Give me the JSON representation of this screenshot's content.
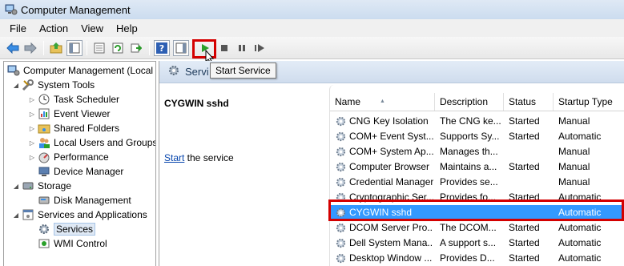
{
  "window": {
    "title": "Computer Management"
  },
  "menu": {
    "items": [
      "File",
      "Action",
      "View",
      "Help"
    ]
  },
  "toolbar": {
    "buttons": [
      "back-icon",
      "forward-icon",
      "up-folder-icon",
      "show-hide-tree-icon",
      "properties-icon",
      "refresh-icon",
      "export-icon",
      "help-icon",
      "show-action-pane-icon",
      "start-service-icon",
      "stop-service-icon",
      "pause-service-icon",
      "restart-service-icon"
    ],
    "tooltip": "Start Service",
    "highlight_color": "#d40000"
  },
  "tree": {
    "root": "Computer Management (Local",
    "system_tools": "System Tools",
    "task_scheduler": "Task Scheduler",
    "event_viewer": "Event Viewer",
    "shared_folders": "Shared Folders",
    "local_users": "Local Users and Groups",
    "performance": "Performance",
    "device_manager": "Device Manager",
    "storage": "Storage",
    "disk_management": "Disk Management",
    "services_apps": "Services and Applications",
    "services": "Services",
    "wmi_control": "WMI Control"
  },
  "right": {
    "header_title": "Servi",
    "selected_service": "CYGWIN sshd",
    "action_link": "Start",
    "action_rest": " the service"
  },
  "columns": {
    "name": "Name",
    "description": "Description",
    "status": "Status",
    "startup": "Startup Type"
  },
  "services": [
    {
      "name": "CNG Key Isolation",
      "description": "The CNG ke...",
      "status": "Started",
      "startup": "Manual"
    },
    {
      "name": "COM+ Event Syst...",
      "description": "Supports Sy...",
      "status": "Started",
      "startup": "Automatic"
    },
    {
      "name": "COM+ System Ap...",
      "description": "Manages th...",
      "status": "",
      "startup": "Manual"
    },
    {
      "name": "Computer Browser",
      "description": "Maintains a...",
      "status": "Started",
      "startup": "Manual"
    },
    {
      "name": "Credential Manager",
      "description": "Provides se...",
      "status": "",
      "startup": "Manual"
    },
    {
      "name": "Cryptographic Ser...",
      "description": "Provides fo...",
      "status": "Started",
      "startup": "Automatic"
    },
    {
      "name": "CYGWIN sshd",
      "description": "",
      "status": "",
      "startup": "Automatic"
    },
    {
      "name": "DCOM Server Pro...",
      "description": "The DCOM...",
      "status": "Started",
      "startup": "Automatic"
    },
    {
      "name": "Dell System Mana...",
      "description": "A support s...",
      "status": "Started",
      "startup": "Automatic"
    },
    {
      "name": "Desktop Window ...",
      "description": "Provides D...",
      "status": "Started",
      "startup": "Automatic"
    }
  ]
}
